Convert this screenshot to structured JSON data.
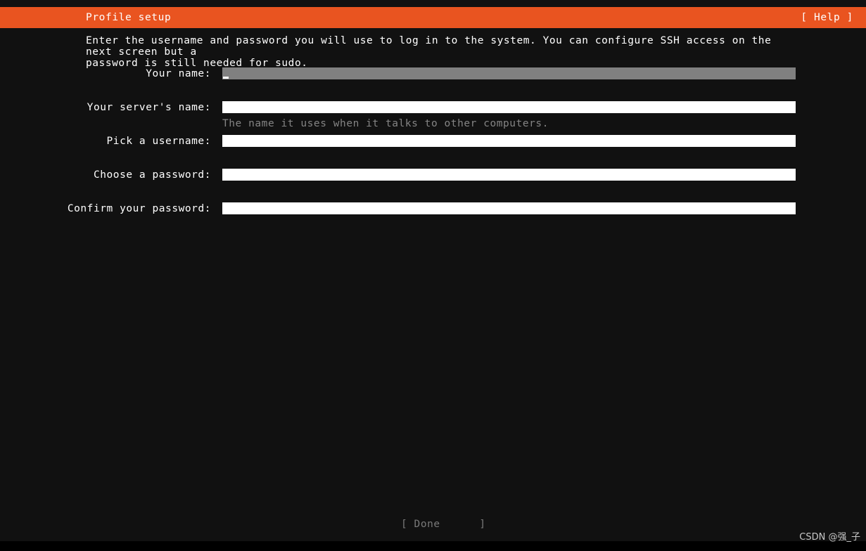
{
  "header": {
    "title": "Profile setup",
    "help_label": "[ Help ]",
    "accent_color": "#e95420",
    "text_color": "#ffffff"
  },
  "main": {
    "description": "Enter the username and password you will use to log in to the system. You can configure SSH access on the next screen but a\npassword is still needed for sudo.",
    "fields": [
      {
        "name": "your-name",
        "label": "Your name:",
        "value": "",
        "hint": "",
        "focused": true,
        "field_color": "#808080"
      },
      {
        "name": "server-name",
        "label": "Your server's name:",
        "value": "",
        "hint": "The name it uses when it talks to other computers.",
        "focused": false,
        "field_color": "#ffffff"
      },
      {
        "name": "username",
        "label": "Pick a username:",
        "value": "",
        "hint": "",
        "focused": false,
        "field_color": "#ffffff"
      },
      {
        "name": "password",
        "label": "Choose a password:",
        "value": "",
        "hint": "",
        "focused": false,
        "field_color": "#ffffff"
      },
      {
        "name": "confirm-password",
        "label": "Confirm your password:",
        "value": "",
        "hint": "",
        "focused": false,
        "field_color": "#ffffff"
      }
    ]
  },
  "footer": {
    "done_label": "[ Done      ]",
    "done_color": "#7a7a7a"
  },
  "watermark": {
    "text": "CSDN @强_子"
  },
  "colors": {
    "background": "#111111",
    "orange": "#e95420",
    "hint_grey": "#848484",
    "focused_field": "#808080"
  }
}
